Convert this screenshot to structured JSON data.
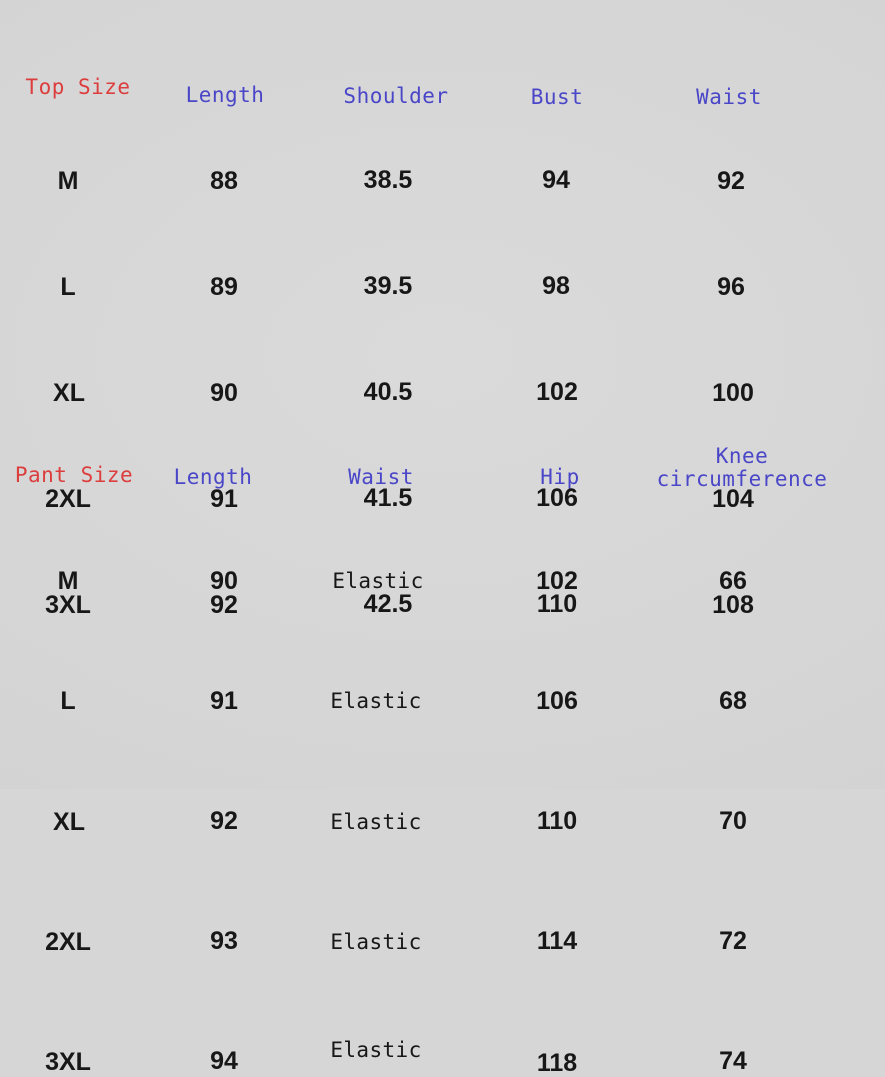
{
  "background_color": "#d6d6d6",
  "header_color_size": "#dc3d3d",
  "header_color_measure": "#4a46c8",
  "value_color": "#171717",
  "tables": [
    {
      "id": "top-size-table",
      "headers": [
        "Top Size",
        "Length",
        "Shoulder",
        "Bust",
        "Waist"
      ],
      "rows": [
        [
          "M",
          "88",
          "38.5",
          "94",
          "92"
        ],
        [
          "L",
          "89",
          "39.5",
          "98",
          "96"
        ],
        [
          "XL",
          "90",
          "40.5",
          "102",
          "100"
        ],
        [
          "2XL",
          "91",
          "41.5",
          "106",
          "104"
        ],
        [
          "3XL",
          "92",
          "42.5",
          "110",
          "108"
        ]
      ]
    },
    {
      "id": "pant-size-table",
      "headers": [
        "Pant Size",
        "Length",
        "Waist",
        "Hip",
        "Knee\ncircumference"
      ],
      "rows": [
        [
          "M",
          "90",
          "Elastic",
          "102",
          "66"
        ],
        [
          "L",
          "91",
          "Elastic",
          "106",
          "68"
        ],
        [
          "XL",
          "92",
          "Elastic",
          "110",
          "70"
        ],
        [
          "2XL",
          "93",
          "Elastic",
          "114",
          "72"
        ],
        [
          "3XL",
          "94",
          "Elastic",
          "118",
          "74"
        ]
      ]
    }
  ]
}
